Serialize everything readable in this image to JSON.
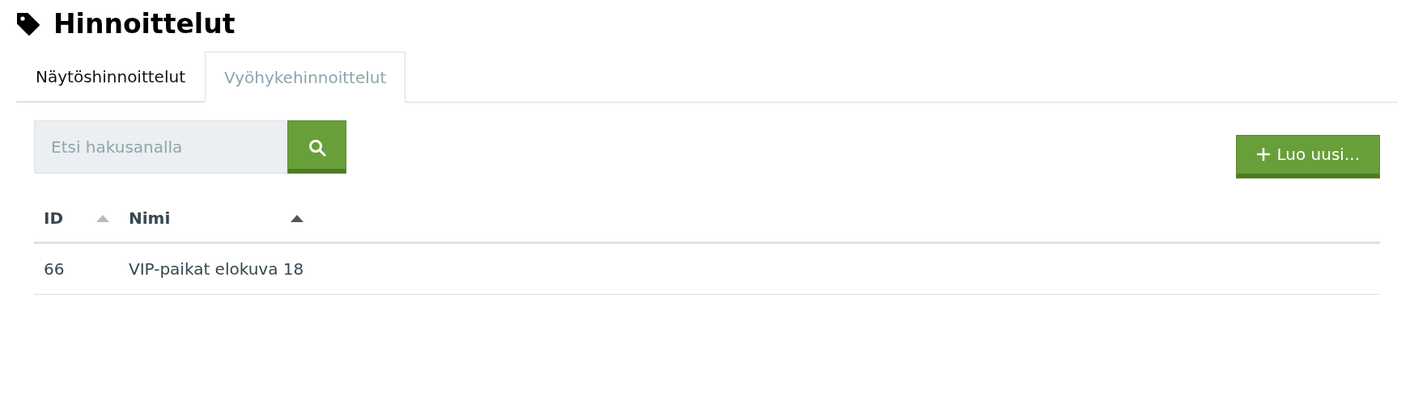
{
  "title": "Hinnoittelut",
  "tabs": [
    {
      "label": "Näytöshinnoittelut",
      "selected": false
    },
    {
      "label": "Vyöhykehinnoittelut",
      "selected": true
    }
  ],
  "search": {
    "placeholder": "Etsi hakusanalla"
  },
  "create_button": {
    "label": "Luo uusi..."
  },
  "table": {
    "columns": [
      {
        "label": "ID",
        "sort_active": false
      },
      {
        "label": "Nimi",
        "sort_active": true
      }
    ],
    "rows": [
      [
        "66",
        "VIP-paikat elokuva 18"
      ]
    ]
  }
}
